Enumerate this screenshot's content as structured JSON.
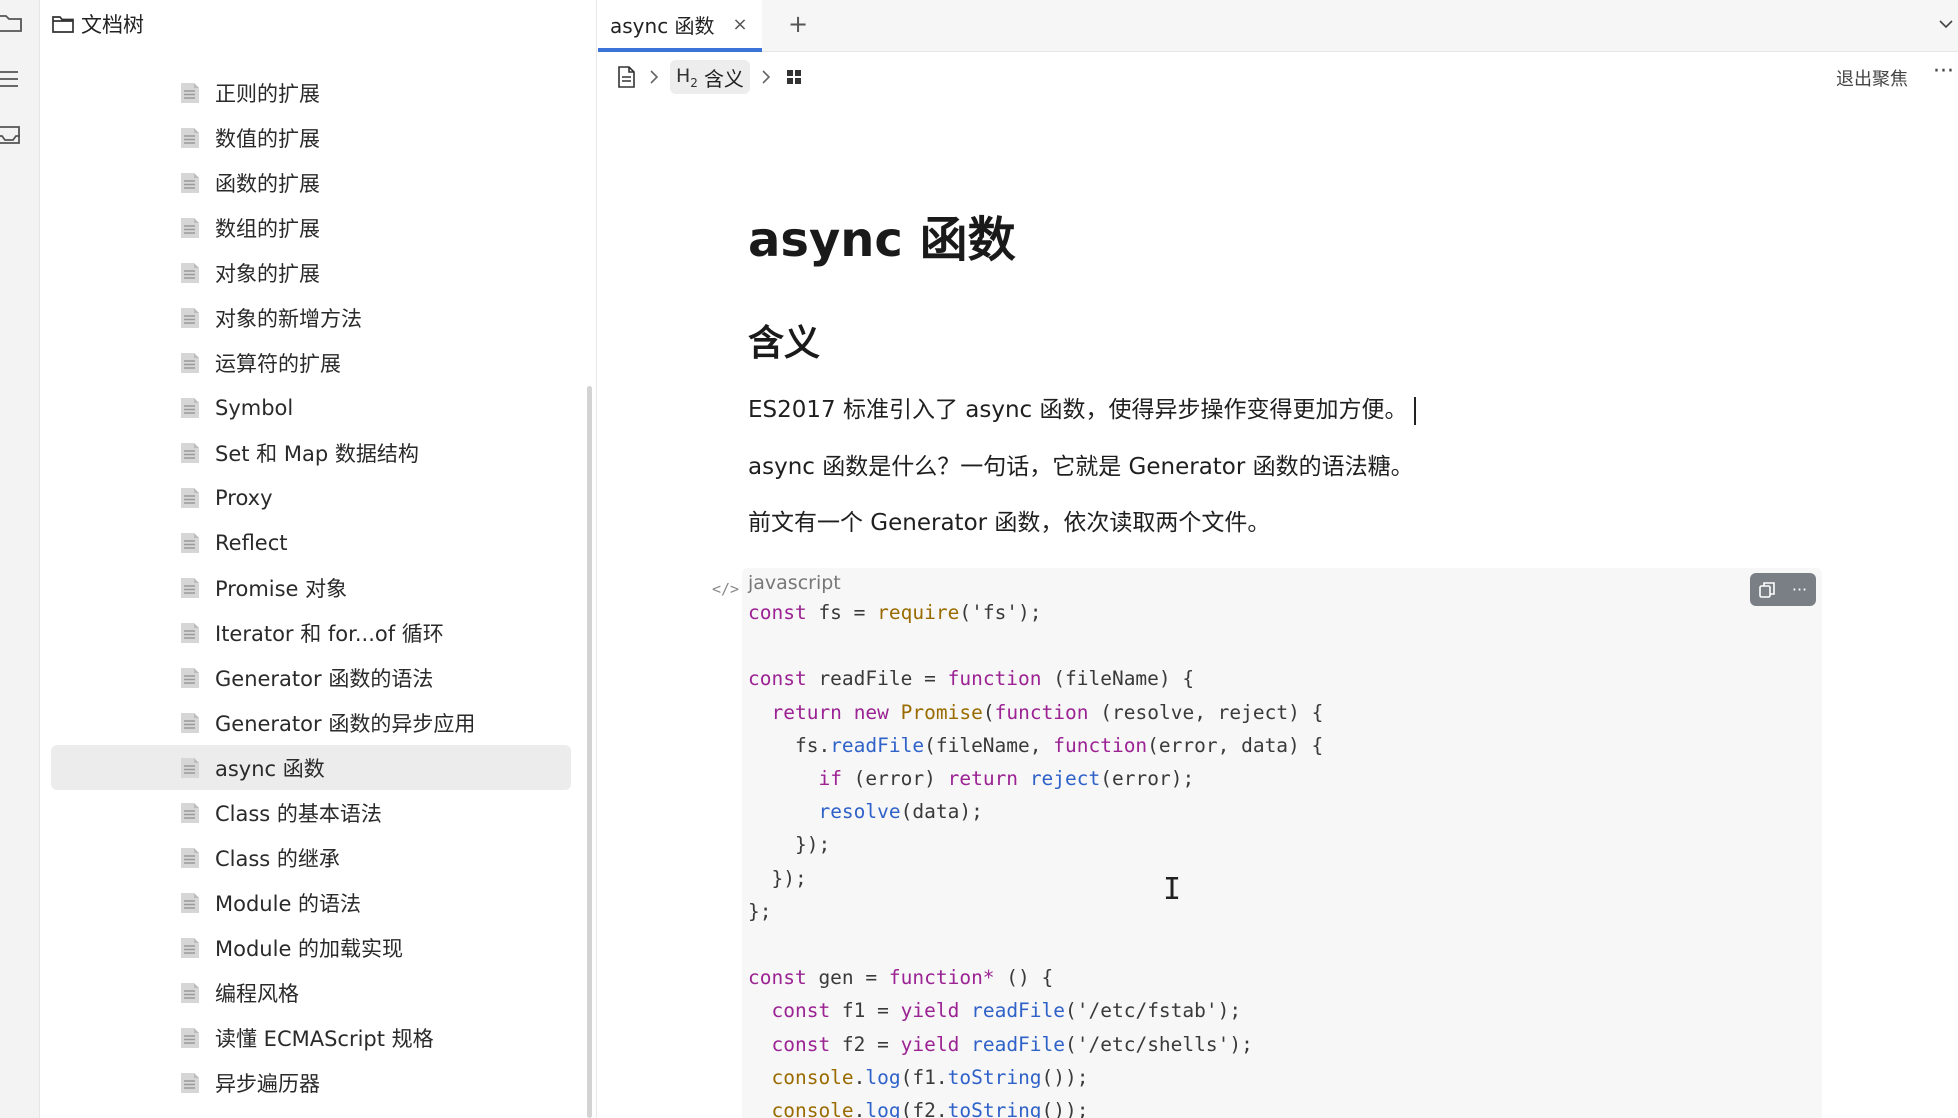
{
  "rail": {
    "icons": [
      "folder-icon",
      "outline-icon",
      "inbox-icon"
    ]
  },
  "tree": {
    "title": "文档树",
    "items": [
      {
        "label": "正则的扩展",
        "active": false
      },
      {
        "label": "数值的扩展",
        "active": false
      },
      {
        "label": "函数的扩展",
        "active": false
      },
      {
        "label": "数组的扩展",
        "active": false
      },
      {
        "label": "对象的扩展",
        "active": false
      },
      {
        "label": "对象的新增方法",
        "active": false
      },
      {
        "label": "运算符的扩展",
        "active": false
      },
      {
        "label": "Symbol",
        "active": false
      },
      {
        "label": "Set 和 Map 数据结构",
        "active": false
      },
      {
        "label": "Proxy",
        "active": false
      },
      {
        "label": "Reflect",
        "active": false
      },
      {
        "label": "Promise 对象",
        "active": false
      },
      {
        "label": "Iterator 和 for...of 循环",
        "active": false
      },
      {
        "label": "Generator 函数的语法",
        "active": false
      },
      {
        "label": "Generator 函数的异步应用",
        "active": false
      },
      {
        "label": "async 函数",
        "active": true
      },
      {
        "label": "Class 的基本语法",
        "active": false
      },
      {
        "label": "Class 的继承",
        "active": false
      },
      {
        "label": "Module 的语法",
        "active": false
      },
      {
        "label": "Module 的加载实现",
        "active": false
      },
      {
        "label": "编程风格",
        "active": false
      },
      {
        "label": "读懂 ECMAScript 规格",
        "active": false
      },
      {
        "label": "异步遍历器",
        "active": false
      }
    ]
  },
  "tabs": [
    {
      "label": "async 函数",
      "close": "×"
    }
  ],
  "tab_add": "+",
  "breadcrumb": {
    "heading_tag": "H",
    "heading_level": "2",
    "heading_label": "含义"
  },
  "toolbar": {
    "exit_focus": "退出聚焦",
    "more": "···"
  },
  "doc": {
    "title": "async 函数",
    "h2": "含义",
    "paragraphs": [
      "ES2017 标准引入了 async 函数，使得异步操作变得更加方便。",
      "async 函数是什么？一句话，它就是 Generator 函数的语法糖。",
      "前文有一个 Generator 函数，依次读取两个文件。"
    ],
    "code": {
      "language": "javascript",
      "gutter_icon": "</>",
      "tools": {
        "copy": "copy-icon",
        "more": "···"
      },
      "lines": [
        [
          [
            "k",
            "const"
          ],
          [
            "s",
            " fs = "
          ],
          [
            "r",
            "require"
          ],
          [
            "s",
            "('fs');"
          ]
        ],
        [],
        [
          [
            "k",
            "const"
          ],
          [
            "s",
            " readFile = "
          ],
          [
            "k",
            "function"
          ],
          [
            "s",
            " (fileName) {"
          ]
        ],
        [
          [
            "s",
            "  "
          ],
          [
            "k",
            "return"
          ],
          [
            "s",
            " "
          ],
          [
            "k",
            "new"
          ],
          [
            "s",
            " "
          ],
          [
            "r",
            "Promise"
          ],
          [
            "s",
            "("
          ],
          [
            "k",
            "function"
          ],
          [
            "s",
            " (resolve, reject) {"
          ]
        ],
        [
          [
            "s",
            "    fs."
          ],
          [
            "f",
            "readFile"
          ],
          [
            "s",
            "(fileName, "
          ],
          [
            "k",
            "function"
          ],
          [
            "s",
            "(error, data) {"
          ]
        ],
        [
          [
            "s",
            "      "
          ],
          [
            "k",
            "if"
          ],
          [
            "s",
            " (error) "
          ],
          [
            "k",
            "return"
          ],
          [
            "s",
            " "
          ],
          [
            "f",
            "reject"
          ],
          [
            "s",
            "(error);"
          ]
        ],
        [
          [
            "s",
            "      "
          ],
          [
            "f",
            "resolve"
          ],
          [
            "s",
            "(data);"
          ]
        ],
        [
          [
            "s",
            "    });"
          ]
        ],
        [
          [
            "s",
            "  });"
          ]
        ],
        [
          [
            "s",
            "};"
          ]
        ],
        [],
        [
          [
            "k",
            "const"
          ],
          [
            "s",
            " gen = "
          ],
          [
            "k",
            "function*"
          ],
          [
            "s",
            " () {"
          ]
        ],
        [
          [
            "s",
            "  "
          ],
          [
            "k",
            "const"
          ],
          [
            "s",
            " f1 = "
          ],
          [
            "k",
            "yield"
          ],
          [
            "s",
            " "
          ],
          [
            "f",
            "readFile"
          ],
          [
            "s",
            "('/etc/fstab');"
          ]
        ],
        [
          [
            "s",
            "  "
          ],
          [
            "k",
            "const"
          ],
          [
            "s",
            " f2 = "
          ],
          [
            "k",
            "yield"
          ],
          [
            "s",
            " "
          ],
          [
            "f",
            "readFile"
          ],
          [
            "s",
            "('/etc/shells');"
          ]
        ],
        [
          [
            "s",
            "  "
          ],
          [
            "r",
            "console"
          ],
          [
            "s",
            "."
          ],
          [
            "f",
            "log"
          ],
          [
            "s",
            "(f1."
          ],
          [
            "f",
            "toString"
          ],
          [
            "s",
            "());"
          ]
        ],
        [
          [
            "s",
            "  "
          ],
          [
            "r",
            "console"
          ],
          [
            "s",
            "."
          ],
          [
            "f",
            "log"
          ],
          [
            "s",
            "(f2."
          ],
          [
            "f",
            "toString"
          ],
          [
            "s",
            "());"
          ]
        ]
      ]
    }
  },
  "colors": {
    "accent": "#3b74d9",
    "active_item": "#ececec",
    "code_bg": "#f7f7f7",
    "keyword": "#9b2393",
    "function": "#2f62c8",
    "builtin": "#9a6b00"
  }
}
